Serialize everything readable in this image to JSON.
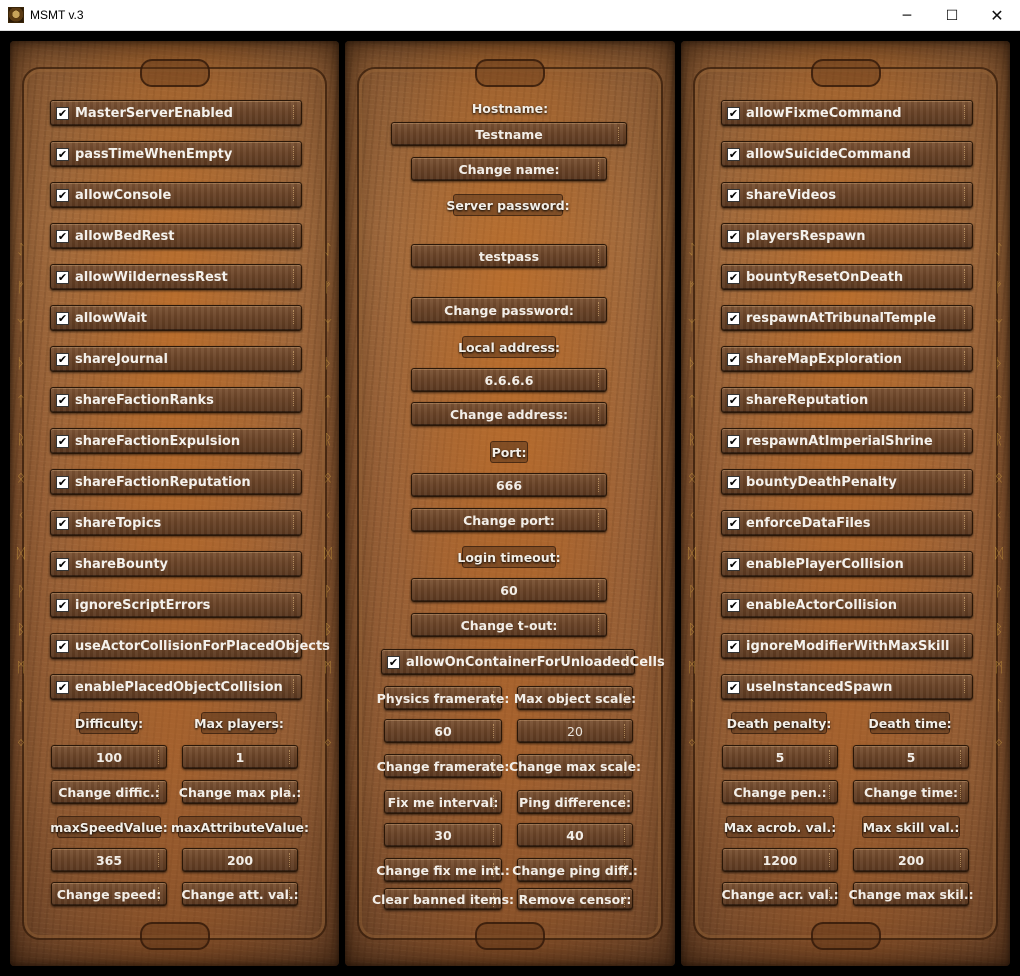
{
  "window": {
    "title": "MSMT v.3",
    "minimize": "─",
    "maximize": "☐",
    "close": "✕"
  },
  "left": {
    "checkboxes": [
      {
        "label": "MasterServerEnabled",
        "checked": true
      },
      {
        "label": "passTimeWhenEmpty",
        "checked": true
      },
      {
        "label": "allowConsole",
        "checked": true
      },
      {
        "label": "allowBedRest",
        "checked": true
      },
      {
        "label": "allowWildernessRest",
        "checked": true
      },
      {
        "label": "allowWait",
        "checked": true
      },
      {
        "label": "shareJournal",
        "checked": true
      },
      {
        "label": "shareFactionRanks",
        "checked": true
      },
      {
        "label": "shareFactionExpulsion",
        "checked": true
      },
      {
        "label": "shareFactionReputation",
        "checked": true
      },
      {
        "label": "shareTopics",
        "checked": true
      },
      {
        "label": "shareBounty",
        "checked": true
      },
      {
        "label": "ignoreScriptErrors",
        "checked": true
      },
      {
        "label": "useActorCollisionForPlacedObjects",
        "checked": true
      },
      {
        "label": "enablePlacedObjectCollision",
        "checked": true
      }
    ],
    "difficulty_label": "Difficulty:",
    "max_players_label": "Max players:",
    "difficulty_value": "100",
    "max_players_value": "1",
    "change_difficulty": "Change diffic.:",
    "change_max_players": "Change max pla.:",
    "max_speed_label": "maxSpeedValue:",
    "max_attribute_label": "maxAttributeValue:",
    "max_speed_value": "365",
    "max_attribute_value": "200",
    "change_speed": "Change speed:",
    "change_attribute": "Change att. val.:"
  },
  "middle": {
    "hostname_label": "Hostname:",
    "hostname_value": "Testname",
    "change_name": "Change name:",
    "password_label": "Server password:",
    "password_value": "testpass",
    "change_password": "Change password:",
    "local_address_label": "Local address:",
    "local_address_value": "6.6.6.6",
    "change_address": "Change address:",
    "port_label": "Port:",
    "port_value": "666",
    "change_port": "Change port:",
    "login_timeout_label": "Login timeout:",
    "login_timeout_value": "60",
    "change_timeout": "Change t-out:",
    "container_checkbox": {
      "label": "allowOnContainerForUnloadedCells",
      "checked": true
    },
    "physics_framerate_label": "Physics framerate:",
    "max_object_scale_label": "Max object scale:",
    "physics_framerate_value": "60",
    "max_object_scale_value": "20",
    "change_framerate": "Change framerate:",
    "change_max_scale": "Change max scale:",
    "fix_me_interval_label": "Fix me interval:",
    "ping_difference_label": "Ping difference:",
    "fix_me_interval_value": "30",
    "ping_difference_value": "40",
    "change_fix_me": "Change fix me int.:",
    "change_ping": "Change ping diff.:",
    "clear_banned": "Clear banned items:",
    "remove_censor": "Remove censor:"
  },
  "right": {
    "checkboxes": [
      {
        "label": "allowFixmeCommand",
        "checked": true
      },
      {
        "label": "allowSuicideCommand",
        "checked": true
      },
      {
        "label": "shareVideos",
        "checked": true
      },
      {
        "label": "playersRespawn",
        "checked": true
      },
      {
        "label": "bountyResetOnDeath",
        "checked": true
      },
      {
        "label": "respawnAtTribunalTemple",
        "checked": true
      },
      {
        "label": "shareMapExploration",
        "checked": true
      },
      {
        "label": "shareReputation",
        "checked": true
      },
      {
        "label": "respawnAtImperialShrine",
        "checked": true
      },
      {
        "label": "bountyDeathPenalty",
        "checked": true
      },
      {
        "label": "enforceDataFiles",
        "checked": true
      },
      {
        "label": "enablePlayerCollision",
        "checked": true
      },
      {
        "label": "enableActorCollision",
        "checked": true
      },
      {
        "label": "ignoreModifierWithMaxSkill",
        "checked": true
      },
      {
        "label": "useInstancedSpawn",
        "checked": true
      }
    ],
    "death_penalty_label": "Death penalty:",
    "death_time_label": "Death time:",
    "death_penalty_value": "5",
    "death_time_value": "5",
    "change_penalty": "Change pen.:",
    "change_time": "Change time:",
    "max_acrobatics_label": "Max acrob. val.:",
    "max_skill_label": "Max skill val.:",
    "max_acrobatics_value": "1200",
    "max_skill_value": "200",
    "change_acrobatics": "Change acr. val.:",
    "change_max_skill": "Change max skil.:"
  }
}
